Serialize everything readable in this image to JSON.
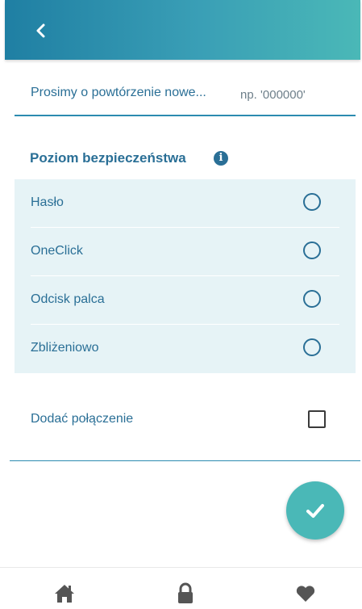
{
  "header": {
    "back_icon": "chevron-left-icon"
  },
  "pin": {
    "label": "Prosimy o powtórzenie nowe...",
    "placeholder": "np. '000000'"
  },
  "security": {
    "title": "Poziom bezpieczeństwa",
    "info_icon": "info-icon",
    "options": [
      {
        "label": "Hasło",
        "selected": false
      },
      {
        "label": "OneClick",
        "selected": false
      },
      {
        "label": "Odcisk palca",
        "selected": false
      },
      {
        "label": "Zbliżeniowo",
        "selected": false
      }
    ]
  },
  "connection": {
    "label": "Dodać połączenie",
    "checked": false
  },
  "confirm": {
    "icon": "check-icon"
  },
  "bottom_nav": [
    {
      "icon": "home-icon"
    },
    {
      "icon": "lock-icon"
    },
    {
      "icon": "heart-icon"
    }
  ],
  "colors": {
    "accent": "#2a6f96",
    "header_gradient_start": "#1f7fa3",
    "header_gradient_end": "#4ab8b7",
    "options_bg": "#e6f3f6",
    "fab": "#4ab8b7"
  }
}
